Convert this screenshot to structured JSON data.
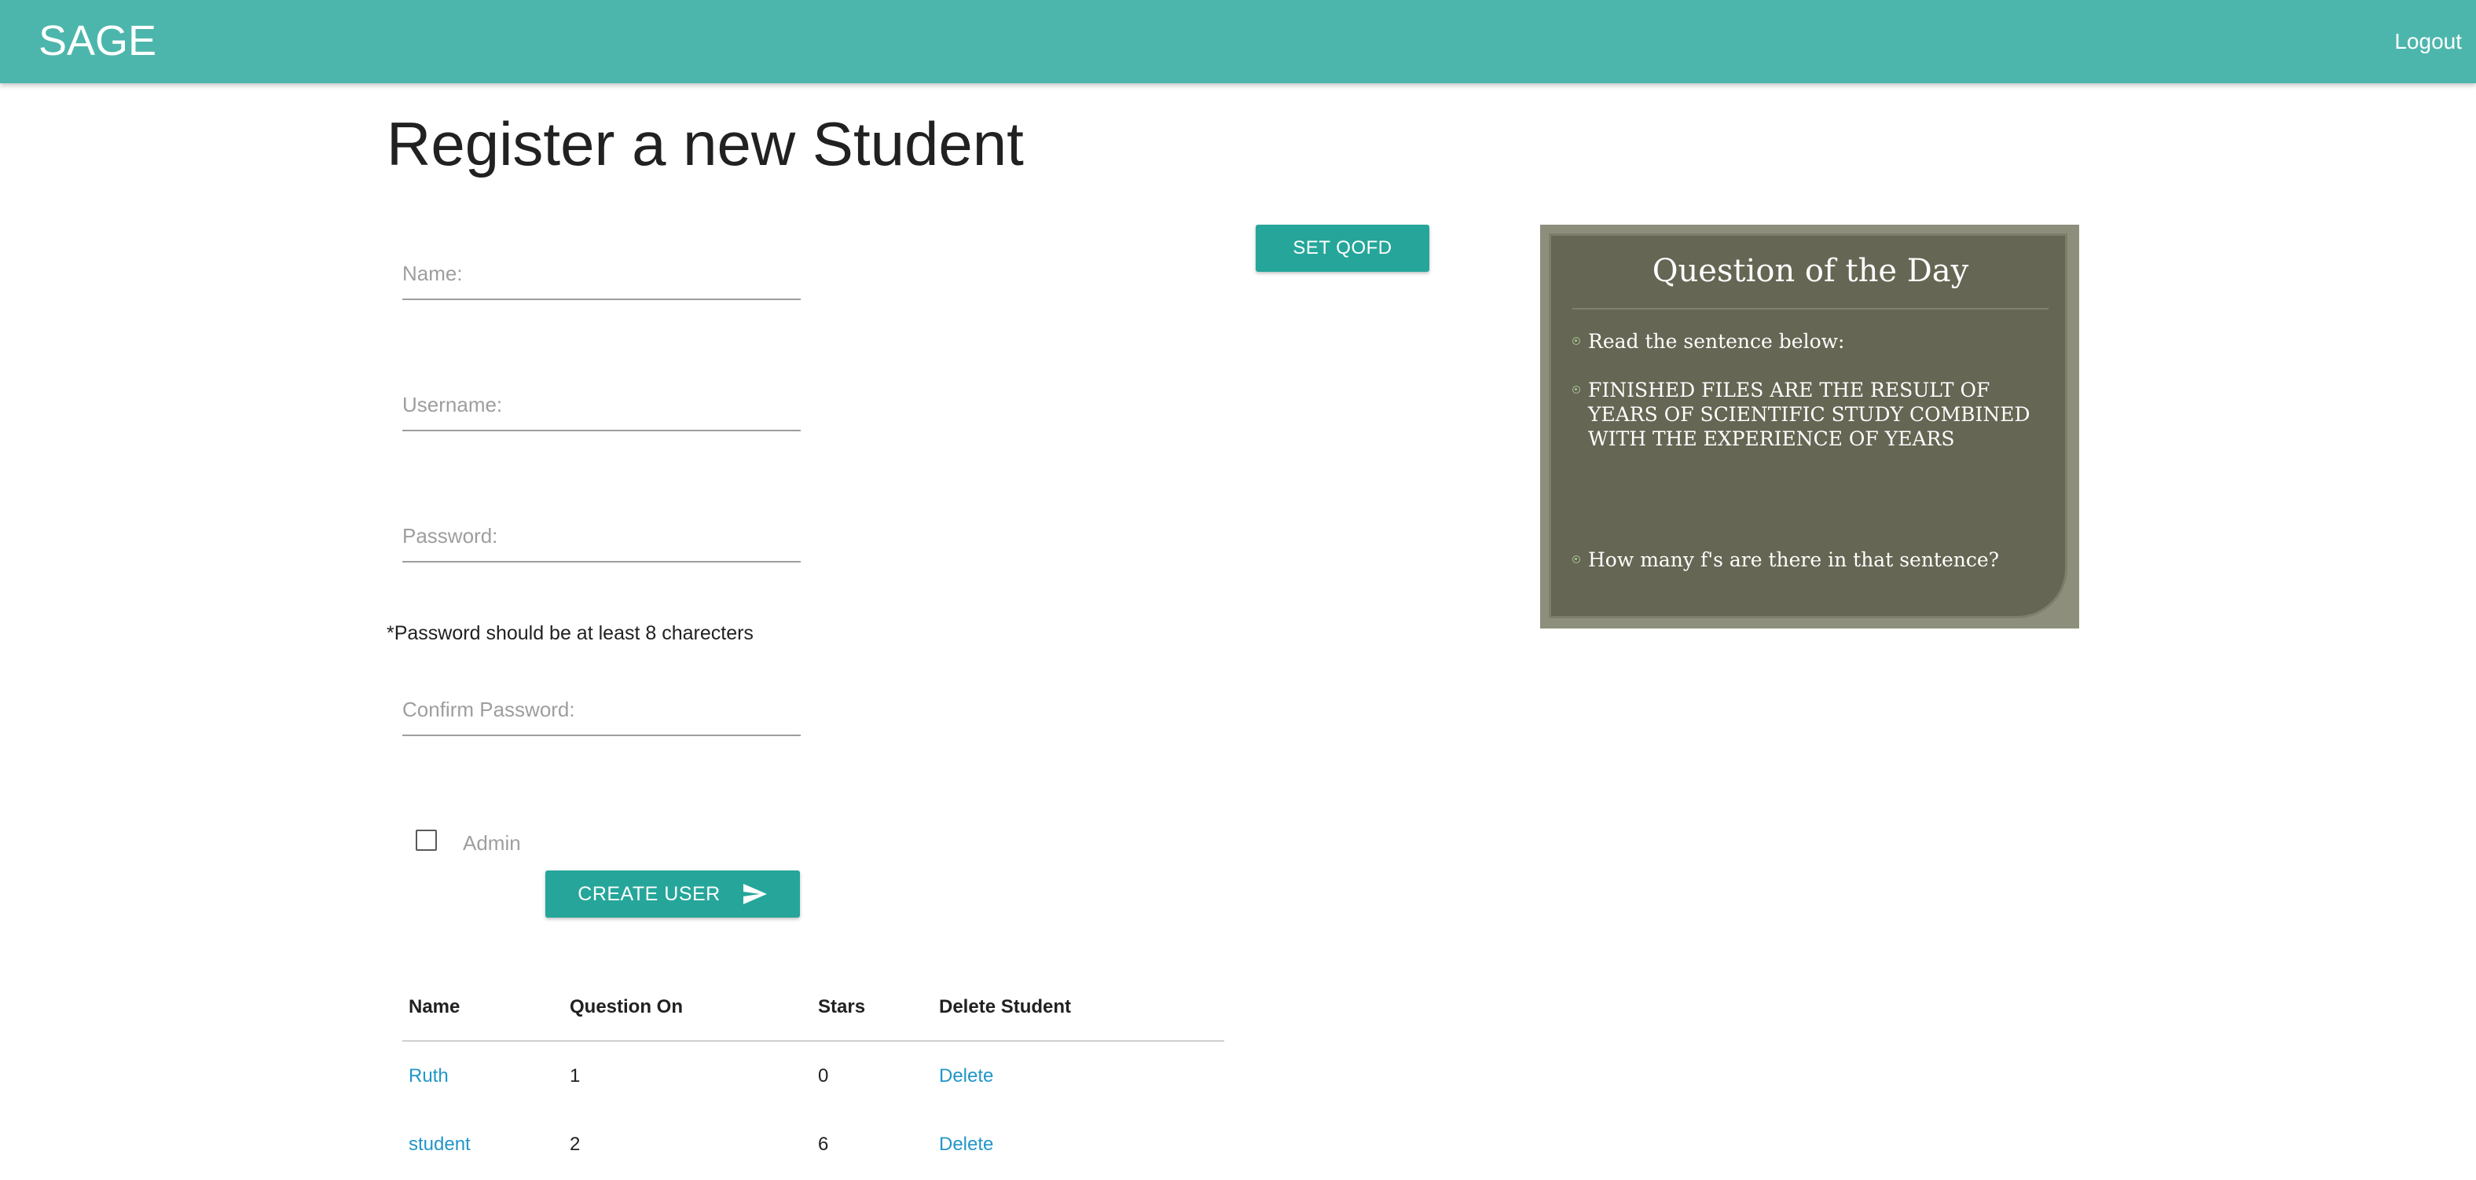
{
  "navbar": {
    "brand": "SAGE",
    "logout_label": "Logout",
    "color": "#4db6ac"
  },
  "page": {
    "title": "Register a new Student"
  },
  "form": {
    "name_placeholder": "Name:",
    "username_placeholder": "Username:",
    "password_placeholder": "Password:",
    "password_hint": "*Password should be at least 8 charecters",
    "confirm_password_placeholder": "Confirm Password:",
    "admin_label": "Admin",
    "admin_checked": false,
    "create_user_label": "CREATE USER",
    "create_user_icon": "send-icon"
  },
  "qofd": {
    "button_label": "SET QOFD",
    "slide_title": "Question of the Day",
    "bullets": [
      "Read the sentence below:",
      "FINISHED FILES ARE THE RESULT OF YEARS OF SCIENTIFIC STUDY COMBINED WITH THE EXPERIENCE OF YEARS",
      "How many f's are there in that sentence?"
    ]
  },
  "students_table": {
    "headers": [
      "Name",
      "Question On",
      "Stars",
      "Delete Student"
    ],
    "rows": [
      {
        "name": "Ruth",
        "question_on": "1",
        "stars": "0",
        "action": "Delete"
      },
      {
        "name": "student",
        "question_on": "2",
        "stars": "6",
        "action": "Delete"
      }
    ]
  },
  "colors": {
    "accent": "#26a69a",
    "link": "#2196c8"
  }
}
